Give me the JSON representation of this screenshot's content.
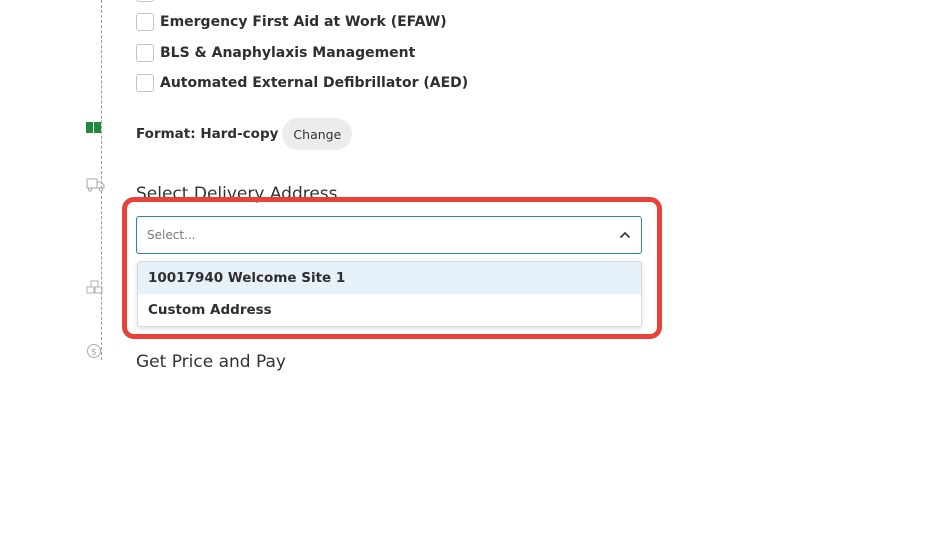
{
  "training_options": [
    {
      "label": "Emergency First Aid at Work (EFAW)",
      "checked": false
    },
    {
      "label": "BLS & Anaphylaxis Management",
      "checked": false
    },
    {
      "label": "Automated External Defibrillator (AED)",
      "checked": false
    }
  ],
  "format": {
    "label": "Format: Hard-copy",
    "change_label": "Change"
  },
  "delivery": {
    "title": "Select Delivery Address",
    "placeholder": "Select...",
    "options": [
      {
        "label": "10017940 Welcome Site 1",
        "highlighted": true
      },
      {
        "label": "Custom Address",
        "highlighted": false
      }
    ]
  },
  "price": {
    "title": "Get Price and Pay"
  },
  "colors": {
    "accent": "#2a80b9",
    "highlight": "#e8413a",
    "option_hover": "#e6f1fa",
    "book_icon": "#1e8a3a"
  },
  "icons": [
    "book-icon",
    "truck-icon",
    "boxes-icon",
    "dollar-icon",
    "chevron-up-icon"
  ]
}
